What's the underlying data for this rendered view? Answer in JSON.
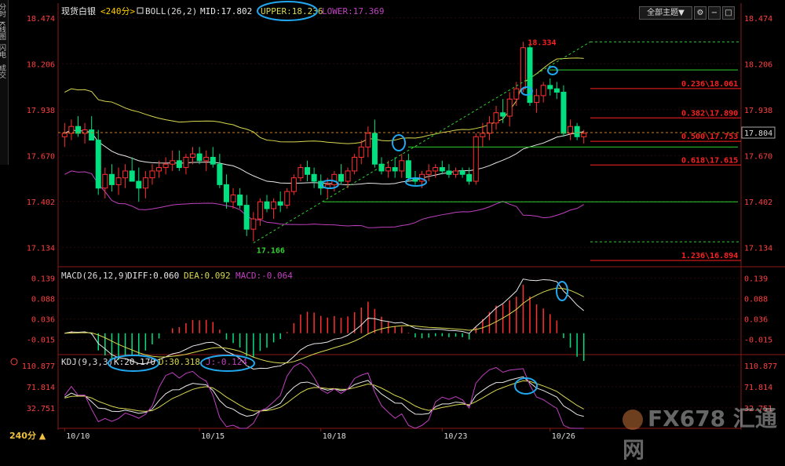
{
  "sidebar": [
    "分时图",
    "K线图",
    "闪电图",
    "成交明细"
  ],
  "header": {
    "instrument": "现货白银",
    "period": "<240分>",
    "boll_label": "BOLL(26,2)",
    "mid": "MID:17.802",
    "upper": "UPPER:18.236",
    "lower": "LOWER:17.369"
  },
  "controls": {
    "indicator_select": "全部主题▼"
  },
  "period_selector": "240分 ▲",
  "logo_text": "FX678 汇通网",
  "annotations": {
    "high": "18.334",
    "low": "17.166",
    "fib": [
      "0.236\\18.061",
      "0.382\\17.890",
      "0.500\\17.753",
      "0.618\\17.615",
      "1.236\\16.894"
    ],
    "current_price": "17.804"
  },
  "macd": {
    "label": "MACD(26,12,9)",
    "diff": "DIFF:0.060",
    "dea": "DEA:0.092",
    "macd": "MACD:-0.064"
  },
  "kdj": {
    "label": "KDJ(9,3,3)",
    "k": "K:20.170",
    "d": "D:30.318",
    "j": "J:-0.124"
  },
  "colors": {
    "up": "#ff3030",
    "down": "#00e080",
    "mid": "#e8e8e8",
    "upper": "#d8d850",
    "lower": "#c040c0",
    "fib": "#ff2020",
    "support": "#30d030",
    "highlight": "#20a8f0"
  },
  "chart_data": [
    {
      "type": "candlestick",
      "title": "现货白银 <240分>",
      "x_ticks": [
        "10/10",
        "10/15",
        "10/18",
        "10/23",
        "10/26"
      ],
      "y_ticks": [
        18.474,
        18.206,
        17.938,
        17.67,
        17.402,
        17.134
      ],
      "ylim": [
        17.03,
        18.56
      ],
      "ohlc": [
        [
          17.78,
          17.86,
          17.72,
          17.8
        ],
        [
          17.8,
          17.88,
          17.76,
          17.84
        ],
        [
          17.84,
          17.9,
          17.78,
          17.8
        ],
        [
          17.8,
          17.86,
          17.74,
          17.82
        ],
        [
          17.82,
          17.9,
          17.78,
          17.76
        ],
        [
          17.76,
          17.82,
          17.44,
          17.48
        ],
        [
          17.48,
          17.6,
          17.42,
          17.56
        ],
        [
          17.56,
          17.62,
          17.46,
          17.5
        ],
        [
          17.5,
          17.6,
          17.44,
          17.54
        ],
        [
          17.54,
          17.62,
          17.48,
          17.58
        ],
        [
          17.58,
          17.66,
          17.52,
          17.52
        ],
        [
          17.52,
          17.6,
          17.4,
          17.48
        ],
        [
          17.48,
          17.58,
          17.42,
          17.54
        ],
        [
          17.54,
          17.62,
          17.5,
          17.58
        ],
        [
          17.58,
          17.64,
          17.54,
          17.6
        ],
        [
          17.6,
          17.66,
          17.56,
          17.62
        ],
        [
          17.62,
          17.7,
          17.58,
          17.64
        ],
        [
          17.64,
          17.7,
          17.58,
          17.6
        ],
        [
          17.6,
          17.68,
          17.56,
          17.66
        ],
        [
          17.66,
          17.72,
          17.62,
          17.68
        ],
        [
          17.68,
          17.72,
          17.62,
          17.64
        ],
        [
          17.64,
          17.7,
          17.58,
          17.66
        ],
        [
          17.66,
          17.72,
          17.6,
          17.62
        ],
        [
          17.62,
          17.68,
          17.48,
          17.5
        ],
        [
          17.5,
          17.56,
          17.36,
          17.4
        ],
        [
          17.4,
          17.48,
          17.36,
          17.44
        ],
        [
          17.44,
          17.48,
          17.36,
          17.38
        ],
        [
          17.38,
          17.44,
          17.2,
          17.24
        ],
        [
          17.24,
          17.34,
          17.17,
          17.3
        ],
        [
          17.3,
          17.42,
          17.26,
          17.4
        ],
        [
          17.4,
          17.44,
          17.34,
          17.36
        ],
        [
          17.36,
          17.42,
          17.3,
          17.4
        ],
        [
          17.4,
          17.46,
          17.34,
          17.38
        ],
        [
          17.38,
          17.48,
          17.36,
          17.46
        ],
        [
          17.46,
          17.56,
          17.44,
          17.54
        ],
        [
          17.54,
          17.62,
          17.52,
          17.6
        ],
        [
          17.6,
          17.64,
          17.52,
          17.56
        ],
        [
          17.56,
          17.6,
          17.48,
          17.52
        ],
        [
          17.52,
          17.56,
          17.44,
          17.48
        ],
        [
          17.48,
          17.54,
          17.42,
          17.5
        ],
        [
          17.5,
          17.58,
          17.46,
          17.56
        ],
        [
          17.56,
          17.62,
          17.5,
          17.52
        ],
        [
          17.52,
          17.6,
          17.48,
          17.58
        ],
        [
          17.58,
          17.68,
          17.56,
          17.66
        ],
        [
          17.66,
          17.76,
          17.62,
          17.72
        ],
        [
          17.72,
          17.84,
          17.66,
          17.8
        ],
        [
          17.8,
          17.88,
          17.6,
          17.62
        ],
        [
          17.62,
          17.66,
          17.56,
          17.58
        ],
        [
          17.58,
          17.64,
          17.54,
          17.6
        ],
        [
          17.6,
          17.66,
          17.54,
          17.58
        ],
        [
          17.58,
          17.68,
          17.54,
          17.64
        ],
        [
          17.64,
          17.68,
          17.52,
          17.54
        ],
        [
          17.54,
          17.58,
          17.5,
          17.52
        ],
        [
          17.52,
          17.58,
          17.48,
          17.56
        ],
        [
          17.56,
          17.62,
          17.52,
          17.58
        ],
        [
          17.58,
          17.62,
          17.54,
          17.6
        ],
        [
          17.6,
          17.64,
          17.56,
          17.58
        ],
        [
          17.58,
          17.62,
          17.54,
          17.56
        ],
        [
          17.56,
          17.6,
          17.54,
          17.58
        ],
        [
          17.58,
          17.6,
          17.54,
          17.56
        ],
        [
          17.56,
          17.6,
          17.5,
          17.52
        ],
        [
          17.52,
          17.8,
          17.5,
          17.78
        ],
        [
          17.78,
          17.86,
          17.72,
          17.8
        ],
        [
          17.8,
          17.9,
          17.76,
          17.86
        ],
        [
          17.86,
          17.96,
          17.82,
          17.92
        ],
        [
          17.92,
          18.0,
          17.86,
          17.9
        ],
        [
          17.9,
          18.04,
          17.84,
          18.0
        ],
        [
          18.0,
          18.1,
          17.96,
          18.06
        ],
        [
          18.06,
          18.334,
          18.04,
          18.3
        ],
        [
          18.3,
          18.32,
          17.96,
          17.98
        ],
        [
          17.98,
          18.06,
          17.92,
          18.02
        ],
        [
          18.02,
          18.1,
          17.98,
          18.08
        ],
        [
          18.08,
          18.12,
          18.02,
          18.06
        ],
        [
          18.06,
          18.1,
          18.0,
          18.04
        ],
        [
          18.04,
          18.08,
          17.78,
          17.8
        ],
        [
          17.8,
          17.88,
          17.76,
          17.84
        ],
        [
          17.84,
          17.86,
          17.76,
          17.78
        ],
        [
          17.78,
          17.82,
          17.74,
          17.8
        ]
      ],
      "overlays": {
        "boll_period": 26,
        "boll_k": 2
      }
    },
    {
      "type": "bar+line",
      "title": "MACD(26,12,9)",
      "y_ticks": [
        0.139,
        0.088,
        0.036,
        -0.015
      ],
      "ylim": [
        -0.05,
        0.16
      ]
    },
    {
      "type": "line",
      "title": "KDJ(9,3,3)",
      "y_ticks": [
        110.877,
        71.814,
        32.751
      ],
      "ylim": [
        -5,
        125
      ]
    }
  ]
}
